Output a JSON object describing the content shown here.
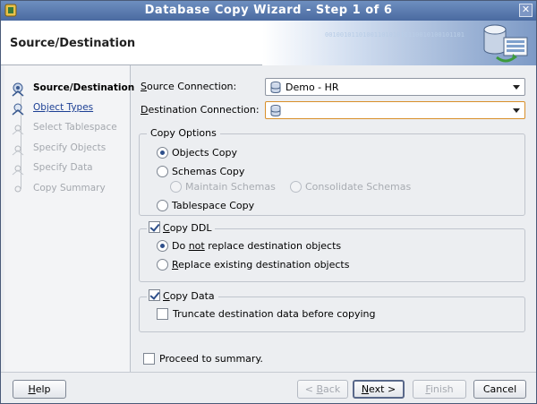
{
  "window": {
    "title": "Database Copy Wizard - Step 1 of 6",
    "close_glyph": "✕"
  },
  "header": {
    "title": "Source/Destination",
    "banner_bits": "0010010110100110101010110010100101101"
  },
  "nav": {
    "items": [
      {
        "label": "Source/Destination",
        "state": "current"
      },
      {
        "label": "Object Types",
        "state": "link"
      },
      {
        "label": "Select Tablespace",
        "state": "disabled"
      },
      {
        "label": "Specify Objects",
        "state": "disabled"
      },
      {
        "label": "Specify Data",
        "state": "disabled"
      },
      {
        "label": "Copy Summary",
        "state": "disabled"
      }
    ]
  },
  "form": {
    "source_label_pre": "",
    "source_label_key": "S",
    "source_label_post": "ource Connection:",
    "source_value": "Demo - HR",
    "dest_label_pre": "",
    "dest_label_key": "D",
    "dest_label_post": "estination Connection:",
    "dest_value": ""
  },
  "copy_options": {
    "title": "Copy Options",
    "objects_copy": "Objects Copy",
    "schemas_copy": "Schemas Copy",
    "maintain_schemas": "Maintain Schemas",
    "consolidate_schemas": "Consolidate Schemas",
    "tablespace_copy": "Tablespace Copy"
  },
  "copy_ddl": {
    "title_key": "C",
    "title_post": "opy DDL",
    "opt1_pre": "Do ",
    "opt1_key": "not",
    "opt1_post": " replace destination objects",
    "opt2_key": "R",
    "opt2_post": "eplace existing destination objects"
  },
  "copy_data": {
    "title_key": "C",
    "title_post": "opy Data",
    "truncate": "Truncate destination data before copying"
  },
  "proceed": "Proceed to summary.",
  "buttons": {
    "help_key": "H",
    "help_post": "elp",
    "back_pre": "< ",
    "back_key": "B",
    "back_post": "ack",
    "next_key": "N",
    "next_post": "ext >",
    "finish_key": "F",
    "finish_post": "inish",
    "cancel": "Cancel"
  },
  "colors": {
    "titlebar": "#5877ab",
    "link": "#1c3f94",
    "focus": "#d88f2a"
  }
}
